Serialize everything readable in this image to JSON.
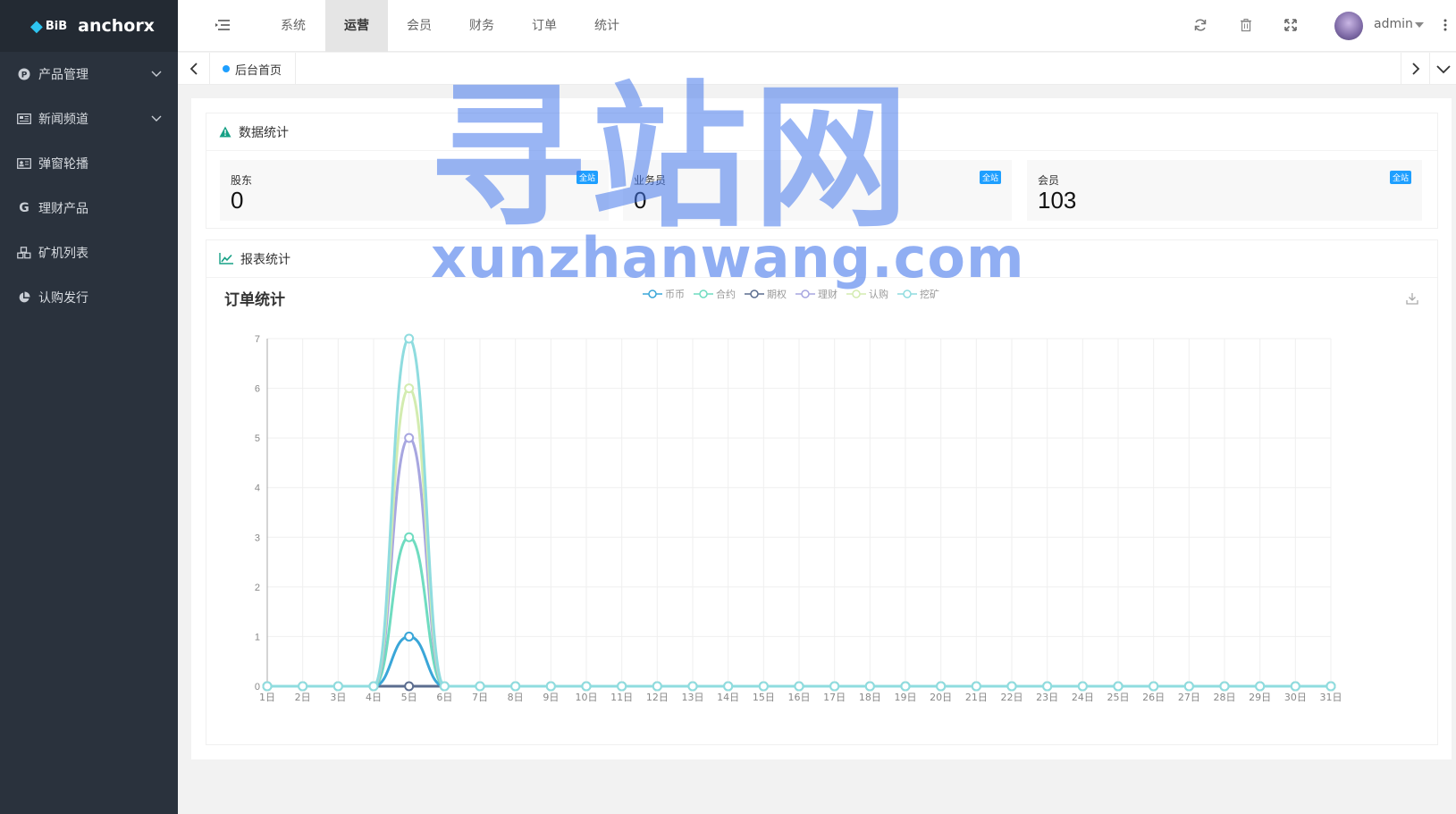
{
  "brand": {
    "logo_text": "BiB",
    "name": "anchorx"
  },
  "sidebar": {
    "items": [
      {
        "label": "产品管理",
        "icon": "p-circle-icon",
        "expandable": true
      },
      {
        "label": "新闻频道",
        "icon": "newspaper-icon",
        "expandable": true
      },
      {
        "label": "弹窗轮播",
        "icon": "id-card-icon",
        "expandable": false
      },
      {
        "label": "理财产品",
        "icon": "g-letter-icon",
        "expandable": false
      },
      {
        "label": "矿机列表",
        "icon": "cubes-icon",
        "expandable": false
      },
      {
        "label": "认购发行",
        "icon": "pie-chart-icon",
        "expandable": false
      }
    ]
  },
  "header": {
    "tabs": [
      {
        "label": "系统",
        "active": false
      },
      {
        "label": "运营",
        "active": true
      },
      {
        "label": "会员",
        "active": false
      },
      {
        "label": "财务",
        "active": false
      },
      {
        "label": "订单",
        "active": false
      },
      {
        "label": "统计",
        "active": false
      }
    ],
    "user": "admin"
  },
  "tabbar": {
    "current_tab": "后台首页"
  },
  "stats": {
    "title": "数据统计",
    "items": [
      {
        "label": "股东",
        "value": "0",
        "badge": "全站"
      },
      {
        "label": "业务员",
        "value": "0",
        "badge": "全站"
      },
      {
        "label": "会员",
        "value": "103",
        "badge": "全站"
      }
    ]
  },
  "report": {
    "title": "报表统计"
  },
  "watermark": {
    "big": "寻站网",
    "small": "xunzhanwang.com"
  },
  "colors": {
    "accent": "#1e9fff",
    "sidebar": "#2a323d",
    "success": "#16a085"
  },
  "chart_data": {
    "type": "line",
    "title": "订单统计",
    "categories": [
      "1日",
      "2日",
      "3日",
      "4日",
      "5日",
      "6日",
      "7日",
      "8日",
      "9日",
      "10日",
      "11日",
      "12日",
      "13日",
      "14日",
      "15日",
      "16日",
      "17日",
      "18日",
      "19日",
      "20日",
      "21日",
      "22日",
      "23日",
      "24日",
      "25日",
      "26日",
      "27日",
      "28日",
      "29日",
      "30日",
      "31日"
    ],
    "ylim": [
      0,
      7
    ],
    "yticks": [
      0,
      1,
      2,
      3,
      4,
      5,
      6,
      7
    ],
    "grid": true,
    "legend_position": "top-center",
    "series": [
      {
        "name": "币币",
        "color": "#3aa6d8",
        "values": [
          0,
          0,
          0,
          0,
          1,
          0,
          0,
          0,
          0,
          0,
          0,
          0,
          0,
          0,
          0,
          0,
          0,
          0,
          0,
          0,
          0,
          0,
          0,
          0,
          0,
          0,
          0,
          0,
          0,
          0,
          0
        ]
      },
      {
        "name": "合约",
        "color": "#6fdcc0",
        "values": [
          0,
          0,
          0,
          0,
          3,
          0,
          0,
          0,
          0,
          0,
          0,
          0,
          0,
          0,
          0,
          0,
          0,
          0,
          0,
          0,
          0,
          0,
          0,
          0,
          0,
          0,
          0,
          0,
          0,
          0,
          0
        ]
      },
      {
        "name": "期权",
        "color": "#5b6d8f",
        "values": [
          0,
          0,
          0,
          0,
          0,
          0,
          0,
          0,
          0,
          0,
          0,
          0,
          0,
          0,
          0,
          0,
          0,
          0,
          0,
          0,
          0,
          0,
          0,
          0,
          0,
          0,
          0,
          0,
          0,
          0,
          0
        ]
      },
      {
        "name": "理财",
        "color": "#a7a6e0",
        "values": [
          0,
          0,
          0,
          0,
          5,
          0,
          0,
          0,
          0,
          0,
          0,
          0,
          0,
          0,
          0,
          0,
          0,
          0,
          0,
          0,
          0,
          0,
          0,
          0,
          0,
          0,
          0,
          0,
          0,
          0,
          0
        ]
      },
      {
        "name": "认购",
        "color": "#d3ecb0",
        "values": [
          0,
          0,
          0,
          0,
          6,
          0,
          0,
          0,
          0,
          0,
          0,
          0,
          0,
          0,
          0,
          0,
          0,
          0,
          0,
          0,
          0,
          0,
          0,
          0,
          0,
          0,
          0,
          0,
          0,
          0,
          0
        ]
      },
      {
        "name": "挖矿",
        "color": "#8fdcdf",
        "values": [
          0,
          0,
          0,
          0,
          7,
          0,
          0,
          0,
          0,
          0,
          0,
          0,
          0,
          0,
          0,
          0,
          0,
          0,
          0,
          0,
          0,
          0,
          0,
          0,
          0,
          0,
          0,
          0,
          0,
          0,
          0
        ]
      }
    ]
  }
}
